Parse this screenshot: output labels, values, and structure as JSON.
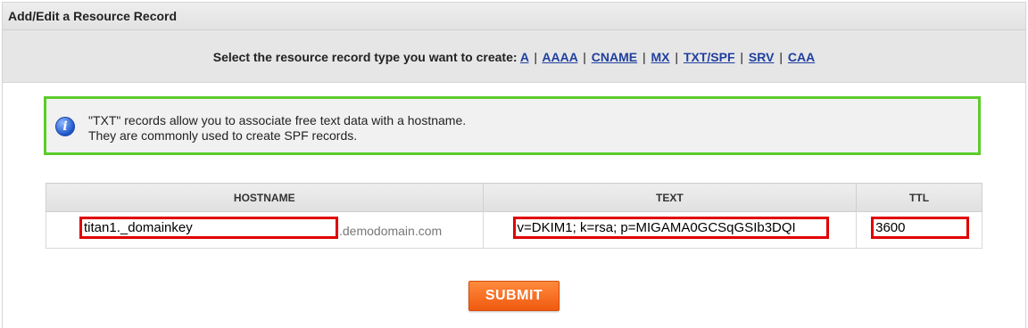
{
  "panel": {
    "title": "Add/Edit a Resource Record"
  },
  "type_selector": {
    "prompt": "Select the resource record type you want to create:",
    "types": [
      "A",
      "AAAA",
      "CNAME",
      "MX",
      "TXT/SPF",
      "SRV",
      "CAA"
    ],
    "separator": "|"
  },
  "info": {
    "icon": "info-icon",
    "line1": "\"TXT\" records allow you to associate free text data with a hostname.",
    "line2": "They are commonly used to create SPF records.",
    "border_color": "#5ccc2a"
  },
  "table": {
    "headers": {
      "hostname": "HOSTNAME",
      "text": "TEXT",
      "ttl": "TTL"
    },
    "row": {
      "hostname_value": "titan1._domainkey",
      "domain_suffix": ".demodomain.com",
      "text_value": "v=DKIM1; k=rsa; p=MIGAMA0GCSqGSIb3DQI",
      "ttl_value": "3600"
    }
  },
  "submit": {
    "label": "SUBMIT",
    "color": "#f05a10"
  },
  "highlight_color": "#e00000"
}
